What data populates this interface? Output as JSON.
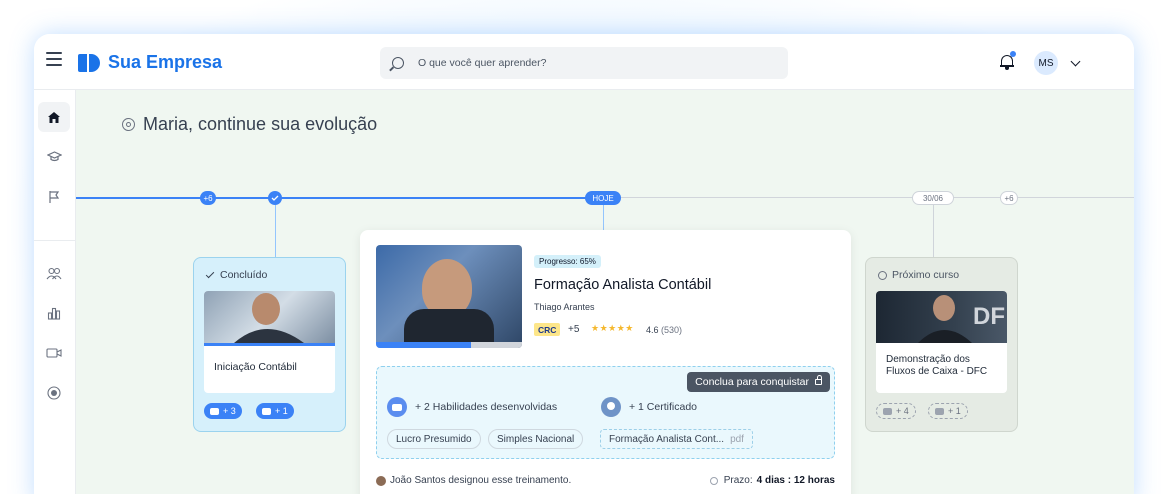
{
  "header": {
    "brand": "Sua Empresa",
    "search_placeholder": "O que você quer aprender?",
    "user_initials": "MS"
  },
  "sidebar": {
    "items": [
      {
        "icon": "home-icon",
        "active": true
      },
      {
        "icon": "graduation-cap-icon"
      },
      {
        "icon": "flag-icon"
      },
      {
        "icon": "users-icon"
      },
      {
        "icon": "bar-chart-icon"
      },
      {
        "icon": "video-icon"
      },
      {
        "icon": "record-icon"
      }
    ]
  },
  "main": {
    "greeting": "Maria, continue sua evolução"
  },
  "timeline": {
    "past_more": "+6",
    "today": "HOJE",
    "next_date": "30/06",
    "future_more": "+6"
  },
  "completed_card": {
    "status": "Concluído",
    "title": "Iniciação Contábil",
    "skills_badge": "+ 3",
    "cert_badge": "+ 1"
  },
  "current_card": {
    "progress_label": "Progresso: 65%",
    "progress": 65,
    "title": "Formação Analista Contábil",
    "instructor": "Thiago Arantes",
    "accreditation": "CRC",
    "accreditation_more": "+5",
    "rating": "4.6",
    "rating_count": "(530)",
    "conquer_label": "Conclua para conquistar",
    "skills_text": "+ 2 Habilidades desenvolvidas",
    "cert_text": "+ 1 Certificado",
    "tags": [
      "Lucro Presumido",
      "Simples Nacional"
    ],
    "cert_name": "Formação Analista Cont...",
    "cert_ext": "pdf",
    "assigned_text": "João Santos designou esse treinamento.",
    "deadline_label": "Prazo:",
    "deadline_value": "4 dias : 12 horas"
  },
  "next_card": {
    "status": "Próximo curso",
    "title": "Demonstração dos Fluxos de Caixa - DFC",
    "thumb_text": "DF",
    "skills_badge": "+ 4",
    "cert_badge": "+ 1"
  },
  "colors": {
    "accent": "#3b82f6",
    "brand": "#1a73e8",
    "main_bg": "#f0f7f1"
  }
}
